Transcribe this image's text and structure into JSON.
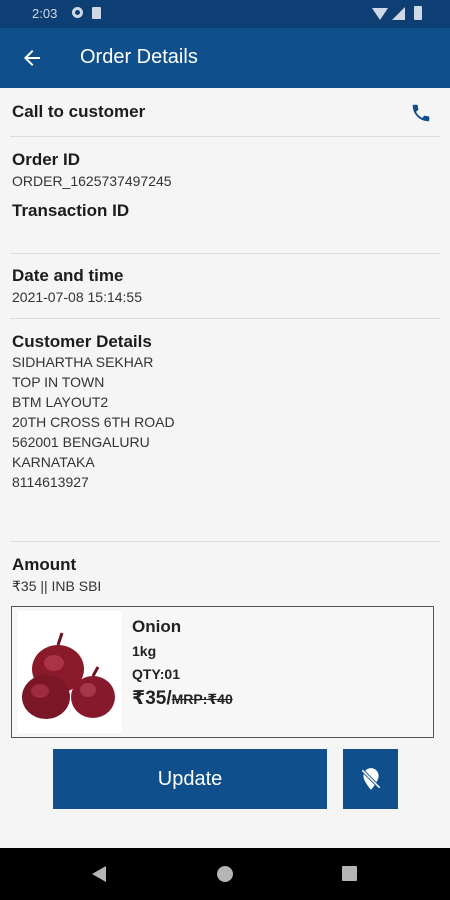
{
  "status_bar": {
    "time": "2:03"
  },
  "app_bar": {
    "title": "Order Details"
  },
  "call_row": {
    "label": "Call to customer"
  },
  "order": {
    "order_id_label": "Order ID",
    "order_id": "ORDER_1625737497245",
    "transaction_id_label": "Transaction ID",
    "transaction_id": ""
  },
  "date_time": {
    "label": "Date and time",
    "value": "2021-07-08 15:14:55"
  },
  "customer": {
    "label": "Customer Details",
    "lines": [
      "SIDHARTHA SEKHAR",
      "TOP IN TOWN",
      "BTM LAYOUT2",
      "20TH CROSS 6TH ROAD",
      "562001 BENGALURU",
      "KARNATAKA",
      "8114613927"
    ]
  },
  "amount": {
    "label": "Amount",
    "value": "₹35 || INB SBI"
  },
  "product": {
    "name": "Onion",
    "weight": "1kg",
    "qty": "QTY:01",
    "price": "₹35/",
    "mrp": "MRP:₹40"
  },
  "actions": {
    "update_label": "Update"
  },
  "icons": {
    "back": "arrow-left-icon",
    "phone": "phone-icon",
    "location_off": "location-off-icon"
  },
  "colors": {
    "primary": "#0f4f8c",
    "status_bar": "#0e3f74"
  }
}
